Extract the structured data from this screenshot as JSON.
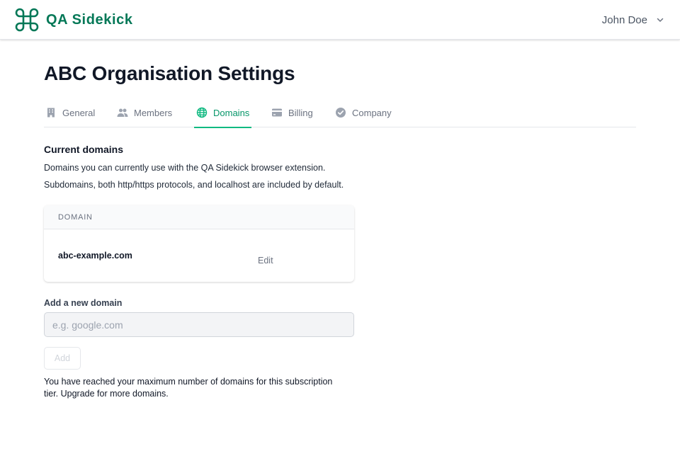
{
  "app": {
    "name": "QA Sidekick",
    "brand_color": "#047857",
    "logo_icon": "command-key-icon"
  },
  "user": {
    "name": "John Doe"
  },
  "page": {
    "title": "ABC Organisation Settings"
  },
  "tabs": [
    {
      "label": "General",
      "icon": "building-icon",
      "active": false
    },
    {
      "label": "Members",
      "icon": "users-icon",
      "active": false
    },
    {
      "label": "Domains",
      "icon": "globe-icon",
      "active": true
    },
    {
      "label": "Billing",
      "icon": "credit-card-icon",
      "active": false
    },
    {
      "label": "Company",
      "icon": "badge-check-icon",
      "active": false
    }
  ],
  "current_domains": {
    "title": "Current domains",
    "description_1": "Domains you can currently use with the QA Sidekick browser extension.",
    "description_2": "Subdomains, both http/https protocols, and localhost are included by default.",
    "table": {
      "column_header": "DOMAIN",
      "rows": [
        {
          "domain": "abc-example.com",
          "action": "Edit"
        }
      ]
    }
  },
  "add_domain": {
    "label": "Add a new domain",
    "placeholder": "e.g. google.com",
    "value": "",
    "button_label": "Add",
    "button_disabled": true,
    "limit_message": "You have reached your maximum number of domains for this subscription tier. Upgrade for more domains."
  },
  "colors": {
    "accent": "#10b981",
    "active_tab_text": "#059669",
    "muted_text": "#6b7280"
  }
}
